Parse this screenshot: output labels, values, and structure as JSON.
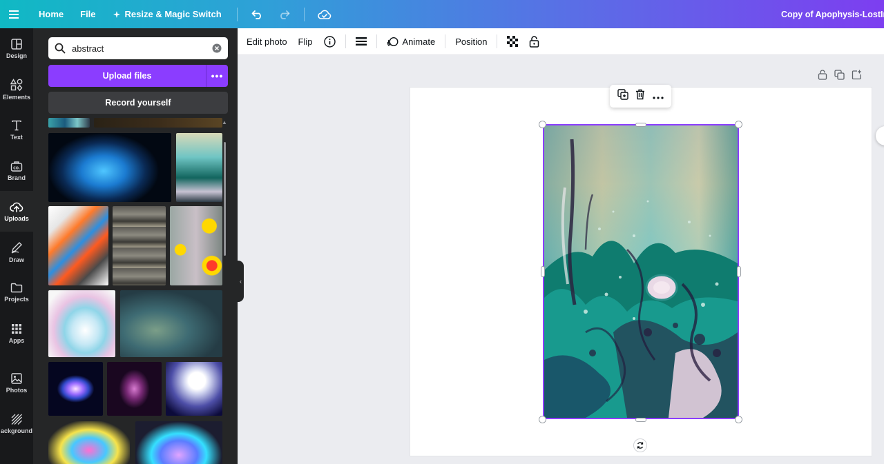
{
  "topbar": {
    "home": "Home",
    "file": "File",
    "resize": "Resize & Magic Switch",
    "doc_title": "Copy of Apophysis-LostInA"
  },
  "rail": {
    "items": [
      {
        "label": "Design",
        "icon": "layout-icon"
      },
      {
        "label": "Elements",
        "icon": "shapes-icon"
      },
      {
        "label": "Text",
        "icon": "text-icon"
      },
      {
        "label": "Brand",
        "icon": "brand-icon"
      },
      {
        "label": "Uploads",
        "icon": "cloud-upload-icon"
      },
      {
        "label": "Draw",
        "icon": "pen-icon"
      },
      {
        "label": "Projects",
        "icon": "folder-icon"
      },
      {
        "label": "Apps",
        "icon": "grid-icon"
      },
      {
        "label": "Photos",
        "icon": "image-icon"
      },
      {
        "label": "ackground",
        "icon": "hatch-icon"
      }
    ]
  },
  "panel": {
    "search_value": "abstract",
    "upload_label": "Upload files",
    "more_label": "•••",
    "record_label": "Record yourself"
  },
  "toolbar": {
    "edit_photo": "Edit photo",
    "flip": "Flip",
    "animate": "Animate",
    "position": "Position"
  },
  "colors": {
    "accent": "#8b3dff",
    "rail_bg": "#18191b",
    "panel_bg": "#252627"
  }
}
